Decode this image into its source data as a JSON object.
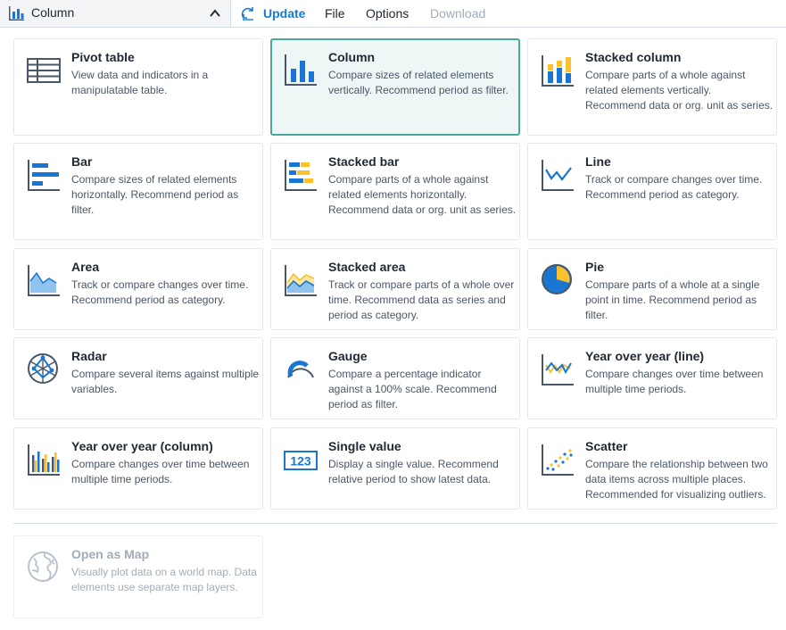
{
  "topbar": {
    "selected_type": "Column",
    "update_label": "Update",
    "file_label": "File",
    "options_label": "Options",
    "download_label": "Download"
  },
  "colors": {
    "accent": "#147cd7",
    "icon_blue": "#1976d2",
    "icon_yellow": "#fbc02d",
    "icon_dark": "#4a5768",
    "selected_border": "#48a999",
    "selected_bg": "#eef7f6"
  },
  "cards": [
    {
      "title": "Pivot table",
      "desc": "View data and indicators in a manipulatable table.",
      "icon": "pivot-table-icon"
    },
    {
      "title": "Column",
      "desc": "Compare sizes of related elements vertically. Recommend period as filter.",
      "icon": "column-chart-icon",
      "selected": true
    },
    {
      "title": "Stacked column",
      "desc": "Compare parts of a whole against related elements vertically. Recommend data or org. unit as series.",
      "icon": "stacked-column-icon"
    },
    {
      "title": "Bar",
      "desc": "Compare sizes of related elements horizontally. Recommend period as filter.",
      "icon": "bar-chart-icon"
    },
    {
      "title": "Stacked bar",
      "desc": "Compare parts of a whole against related elements horizontally. Recommend data or org. unit as series.",
      "icon": "stacked-bar-icon"
    },
    {
      "title": "Line",
      "desc": "Track or compare changes over time. Recommend period as category.",
      "icon": "line-chart-icon"
    },
    {
      "title": "Area",
      "desc": "Track or compare changes over time. Recommend period as category.",
      "icon": "area-chart-icon"
    },
    {
      "title": "Stacked area",
      "desc": "Track or compare parts of a whole over time. Recommend data as series and period as category.",
      "icon": "stacked-area-icon"
    },
    {
      "title": "Pie",
      "desc": "Compare parts of a whole at a single point in time. Recommend period as filter.",
      "icon": "pie-chart-icon"
    },
    {
      "title": "Radar",
      "desc": "Compare several items against multiple variables.",
      "icon": "radar-chart-icon"
    },
    {
      "title": "Gauge",
      "desc": "Compare a percentage indicator against a 100% scale. Recommend period as filter.",
      "icon": "gauge-icon"
    },
    {
      "title": "Year over year (line)",
      "desc": "Compare changes over time between multiple time periods.",
      "icon": "year-over-year-line-icon"
    },
    {
      "title": "Year over year (column)",
      "desc": "Compare changes over time between multiple time periods.",
      "icon": "year-over-year-column-icon"
    },
    {
      "title": "Single value",
      "desc": "Display a single value. Recommend relative period to show latest data.",
      "icon": "single-value-icon",
      "icon_text": "123"
    },
    {
      "title": "Scatter",
      "desc": "Compare the relationship between two data items across multiple places. Recommended for visualizing outliers.",
      "icon": "scatter-chart-icon"
    },
    {
      "title": "Open as Map",
      "desc": "Visually plot data on a world map. Data elements use separate map layers.",
      "icon": "globe-map-icon",
      "disabled": true
    }
  ]
}
